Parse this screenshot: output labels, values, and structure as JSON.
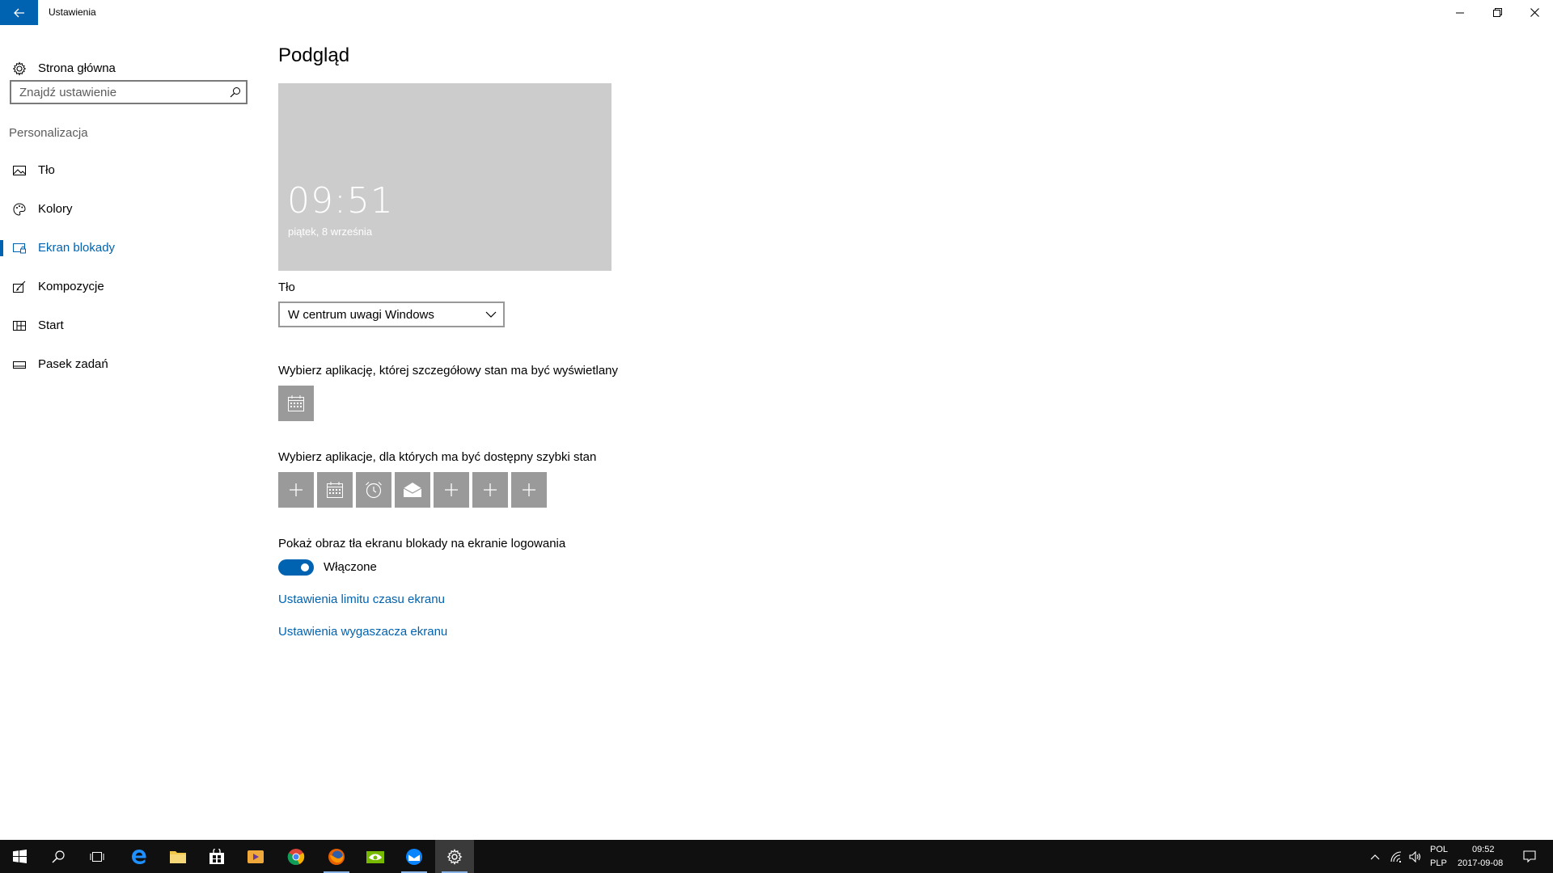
{
  "window": {
    "title": "Ustawienia",
    "back_icon": "arrow-left-icon",
    "controls": [
      "minimize-icon",
      "restore-icon",
      "close-icon"
    ]
  },
  "sidebar": {
    "home_label": "Strona główna",
    "home_icon": "gear-icon",
    "search": {
      "placeholder": "Znajdź ustawienie",
      "value": "",
      "icon": "search-icon"
    },
    "section_heading": "Personalizacja",
    "items": [
      {
        "label": "Tło",
        "icon": "picture-icon",
        "active": false
      },
      {
        "label": "Kolory",
        "icon": "palette-icon",
        "active": false
      },
      {
        "label": "Ekran blokady",
        "icon": "lock-screen-icon",
        "active": true
      },
      {
        "label": "Kompozycje",
        "icon": "brush-icon",
        "active": false
      },
      {
        "label": "Start",
        "icon": "start-icon",
        "active": false
      },
      {
        "label": "Pasek zadań",
        "icon": "taskbar-icon",
        "active": false
      }
    ]
  },
  "main": {
    "title": "Podgląd",
    "preview": {
      "time": "09:51",
      "date": "piątek, 8 września"
    },
    "background_label": "Tło",
    "background_value": "W centrum uwagi Windows",
    "detailed_status_label": "Wybierz aplikację, której szczegółowy stan ma być wyświetlany",
    "detailed_status_app": "calendar-icon",
    "quick_status_label": "Wybierz aplikacje, dla których ma być dostępny szybki stan",
    "quick_status_apps": [
      "plus-icon",
      "calendar-icon",
      "alarm-clock-icon",
      "mail-icon",
      "plus-icon",
      "plus-icon",
      "plus-icon"
    ],
    "show_bg_label": "Pokaż obraz tła ekranu blokady na ekranie logowania",
    "toggle_state": "Włączone",
    "toggle_on": true,
    "link_timeout": "Ustawienia limitu czasu ekranu",
    "link_screensaver": "Ustawienia wygaszacza ekranu"
  },
  "taskbar": {
    "apps": [
      "start-icon",
      "search-icon",
      "task-view-icon",
      "edge-icon",
      "file-explorer-icon",
      "store-icon",
      "media-player-icon",
      "chrome-icon",
      "firefox-icon",
      "nvidia-icon",
      "thunderbird-icon",
      "settings-icon"
    ],
    "tray": {
      "lang_top": "POL",
      "lang_bottom": "PLP",
      "time": "09:52",
      "date": "2017-09-08"
    }
  },
  "colors": {
    "accent": "#0063b1",
    "preview_bg": "#cccccc",
    "tile_bg": "#9a9a9a",
    "taskbar_bg": "#101010"
  }
}
